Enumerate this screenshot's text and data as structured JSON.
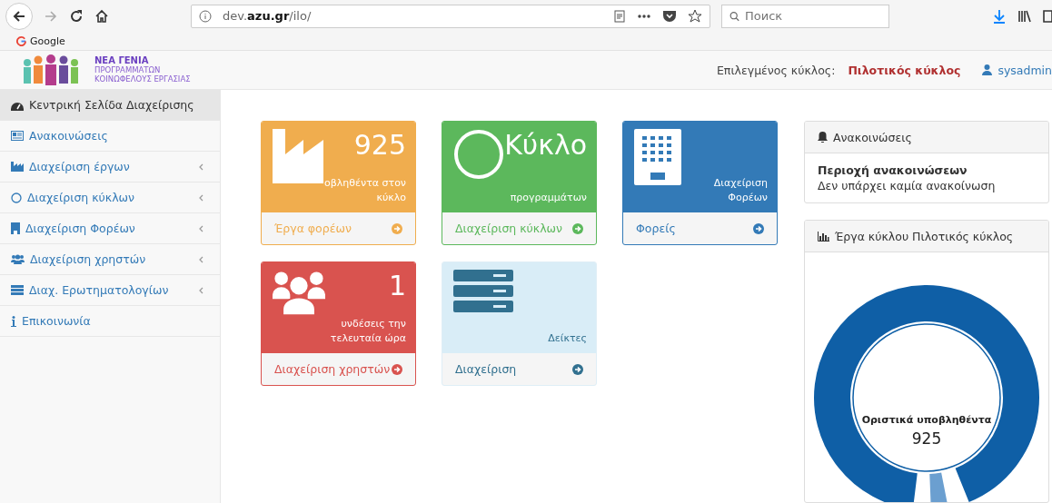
{
  "browser": {
    "address": "dev.**azu.gr**/ilo/",
    "search": {
      "placeholder": "Поиск"
    },
    "bookmarks": [
      "Google"
    ]
  },
  "header": {
    "logo_lines": [
      "ΝΕΑ ΓΕΝΙΑ",
      "ΠΡΟΓΡΑΜΜΑΤΩΝ",
      "ΚΟΙΝΩΦΕΛΟΥΣ ΕΡΓΑΣΙΑΣ"
    ],
    "cycle_label": "Επιλεγμένος κύκλος:",
    "cycle_value": "Πιλοτικός κύκλος",
    "user": "sysadmin"
  },
  "sidebar": {
    "items": [
      {
        "kind": "dashboard",
        "label": "Κεντρική Σελίδα Διαχείρισης",
        "submenu": false,
        "selected": true
      },
      {
        "kind": "newspaper",
        "label": "Ανακοινώσεις",
        "submenu": false,
        "selected": false
      },
      {
        "kind": "chart",
        "label": "Διαχείριση έργων",
        "submenu": true,
        "selected": false
      },
      {
        "kind": "circle",
        "label": "Διαχείριση κύκλων",
        "submenu": true,
        "selected": false
      },
      {
        "kind": "building",
        "label": "Διαχείριση Φορέων",
        "submenu": true,
        "selected": false
      },
      {
        "kind": "users",
        "label": "Διαχείριση χρηστών",
        "submenu": true,
        "selected": false
      },
      {
        "kind": "list",
        "label": "Διαχ. Ερωτηματολογίων",
        "submenu": true,
        "selected": false
      },
      {
        "kind": "info",
        "label": "Επικοινωνία",
        "submenu": false,
        "selected": false
      }
    ]
  },
  "tiles": [
    {
      "kind": "factory",
      "color": "#f0ad4e",
      "big": "925",
      "text": "οβληθέντα στον κύκλο",
      "link": "Έργα φορέων"
    },
    {
      "kind": "cycle",
      "color": "#5cb85c",
      "big": "Κύκλο",
      "text": "προγραμμάτων",
      "link": "Διαχείριση κύκλων"
    },
    {
      "kind": "building",
      "color": "#337ab7",
      "text": "Διαχείριση Φορέων",
      "link": "Φορείς"
    },
    {
      "kind": "users",
      "color": "#d9534f",
      "big": "1",
      "text": "υνδέσεις την τελευταία ώρα",
      "link": "Διαχείριση χρηστών"
    },
    {
      "kind": "server",
      "color": "#d9edf7",
      "text": "Δείκτες",
      "link": "Διαχείριση"
    }
  ],
  "announcements": {
    "title": "Ανακοινώσεις",
    "heading": "Περιοχή ανακοινώσεων",
    "text": "Δεν υπάρχει καμία ανακοίνωση"
  },
  "chart_panel": {
    "title": "Έργα κύκλου Πιλοτικός κύκλος",
    "center_label": "Οριστικά υποβληθέντα",
    "center_value": "925"
  }
}
